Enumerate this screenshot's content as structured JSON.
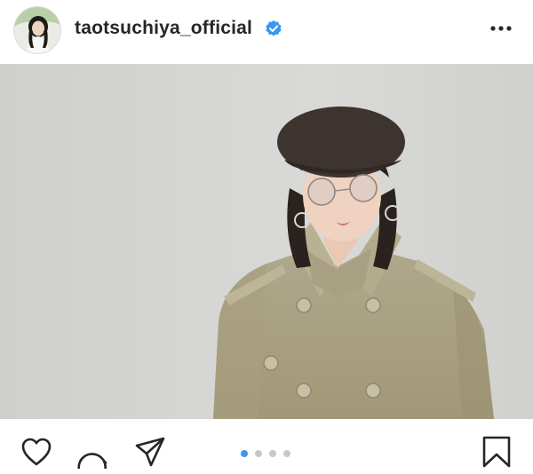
{
  "header": {
    "username": "taotsuchiya_official",
    "verified": true,
    "more_icon": "more-horizontal-icon"
  },
  "photo": {
    "description_icon": "post-photo"
  },
  "actions": {
    "like_icon": "heart-icon",
    "comment_icon": "comment-icon",
    "share_icon": "share-icon",
    "save_icon": "bookmark-icon"
  },
  "carousel": {
    "total": 4,
    "active_index": 0
  },
  "colors": {
    "verified": "#3897f0",
    "active_dot": "#3897f0",
    "inactive_dot": "#c7c7c7"
  }
}
